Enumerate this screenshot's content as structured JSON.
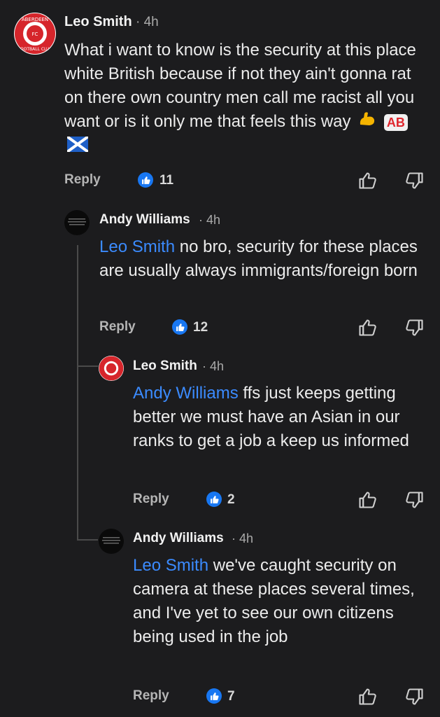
{
  "comments": [
    {
      "author": "Leo Smith",
      "time": "· 4h",
      "text": "What i want to know is the security at this place white British because if not they ain't gonna rat on there own country men call me racist all you want or is it only me that feels this way",
      "emoji_ab": "AB",
      "reply_label": "Reply",
      "likes": "11",
      "avatar_icon": "aberdeen-fc-crest",
      "avatar_text": "ABERDEEN"
    },
    {
      "author": "Andy Williams",
      "time": "· 4h",
      "mention": "Leo Smith",
      "text": " no bro, security for these places are usually always immigrants/foreign born",
      "reply_label": "Reply",
      "likes": "12"
    },
    {
      "author": "Leo Smith",
      "time": "· 4h",
      "mention": "Andy Williams",
      "text": " ffs just keeps getting better we must have an Asian in our ranks to get a job a keep us informed",
      "reply_label": "Reply",
      "likes": "2"
    },
    {
      "author": "Andy Williams",
      "time": "· 4h",
      "mention": "Leo Smith",
      "text": " we've caught security on camera at these places several times, and I've yet to see our own citizens being used in the job",
      "reply_label": "Reply",
      "likes": "7"
    }
  ],
  "colors": {
    "background": "#1c1c1e",
    "mention": "#3b8bff",
    "like_badge": "#1877f2",
    "club_red": "#d6252b"
  }
}
